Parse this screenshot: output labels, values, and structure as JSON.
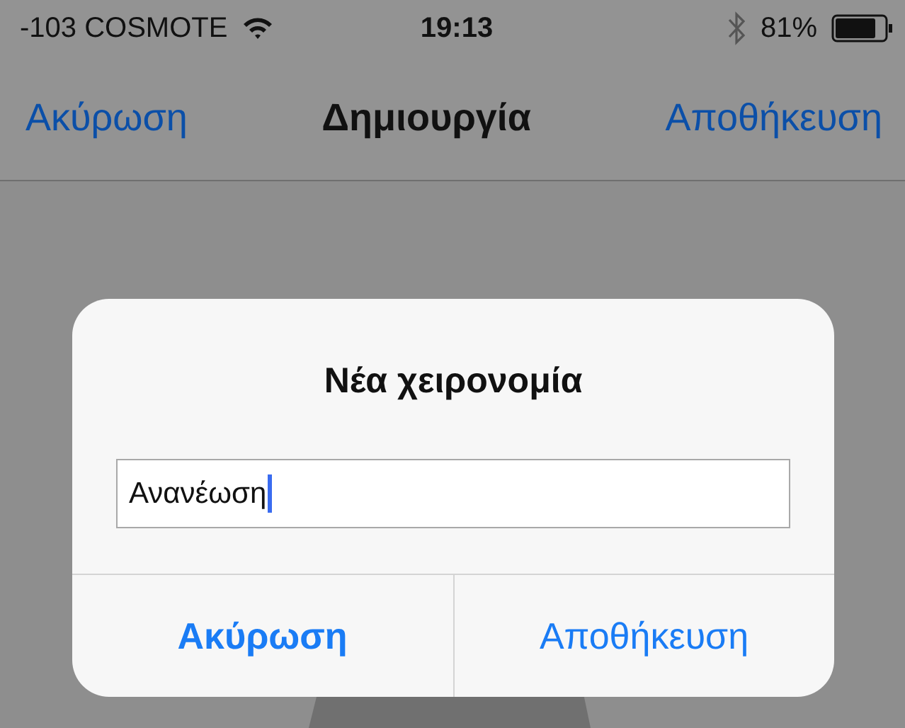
{
  "status_bar": {
    "carrier": "-103 COSMOTE",
    "time": "19:13",
    "battery": "81%"
  },
  "nav_bar": {
    "left": "Ακύρωση",
    "title": "Δημιουργία",
    "right": "Αποθήκευση"
  },
  "dialog": {
    "title": "Νέα χειρονομία",
    "field": {
      "value": "Ανανέωση",
      "focused": true
    },
    "buttons": [
      {
        "label": "Ακύρωση",
        "kind": "cancel"
      },
      {
        "label": "Αποθήκευση",
        "kind": "default"
      }
    ]
  }
}
